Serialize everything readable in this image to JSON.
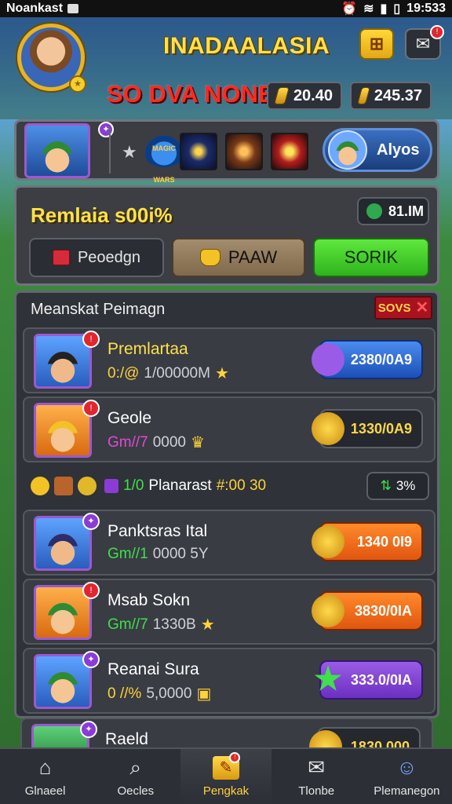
{
  "status_bar": {
    "app_name": "Noankast",
    "time": "19:533"
  },
  "header": {
    "title": "INADAALASIA",
    "subtitle": "SO DVA NONERAS",
    "currency_1": "20.40",
    "currency_2": "245.37"
  },
  "hero_strip": {
    "world_logo_text": "MAGIC WARS",
    "rank_label": "Alyos"
  },
  "promo": {
    "title": "Remlaia s00i%",
    "badge_value": "81.IM",
    "buttons": [
      {
        "label": "Peoedgn"
      },
      {
        "label": "PAAW"
      },
      {
        "label": "SORIK"
      }
    ]
  },
  "list": {
    "heading": "Meanskat Peimagn",
    "tag": "SOVS",
    "rows": [
      {
        "name": "Premlartaa",
        "meta_a": "0:/@",
        "meta_b": "1/00000M",
        "price": "2380/0A9"
      },
      {
        "name": "Geole",
        "meta_a": "Gm//7",
        "meta_b": "0000",
        "price": "1330/0A9"
      },
      {
        "name": "Panktsras Ital",
        "meta_a": "Gm//1",
        "meta_b": "0000 5Y",
        "price": "1340 0I9"
      },
      {
        "name": "Msab Sokn",
        "meta_a": "Gm//7",
        "meta_b": "1330B",
        "price": "3830/0IA"
      },
      {
        "name": "Reanai Sura",
        "meta_a": "0 //%",
        "meta_b": "5,0000",
        "price": "333.0/0IA"
      },
      {
        "name": "Raeld",
        "price": "1830 000"
      }
    ],
    "info_strip": {
      "count": "1/0",
      "label": "Planarast",
      "value": "#:00 30",
      "percent": "3%"
    }
  },
  "tabs": [
    {
      "label": "Glnaeel",
      "icon": "home-icon"
    },
    {
      "label": "Oecles",
      "icon": "search-icon"
    },
    {
      "label": "Pengkak",
      "icon": "quest-icon"
    },
    {
      "label": "Tlonbe",
      "icon": "mail-icon"
    },
    {
      "label": "Plemanegon",
      "icon": "profile-icon"
    }
  ],
  "colors": {
    "accent_gold": "#ffd23a",
    "title_red": "#ff2a20",
    "button_green": "#2fb31d",
    "panel_bg": "#2f3238"
  }
}
